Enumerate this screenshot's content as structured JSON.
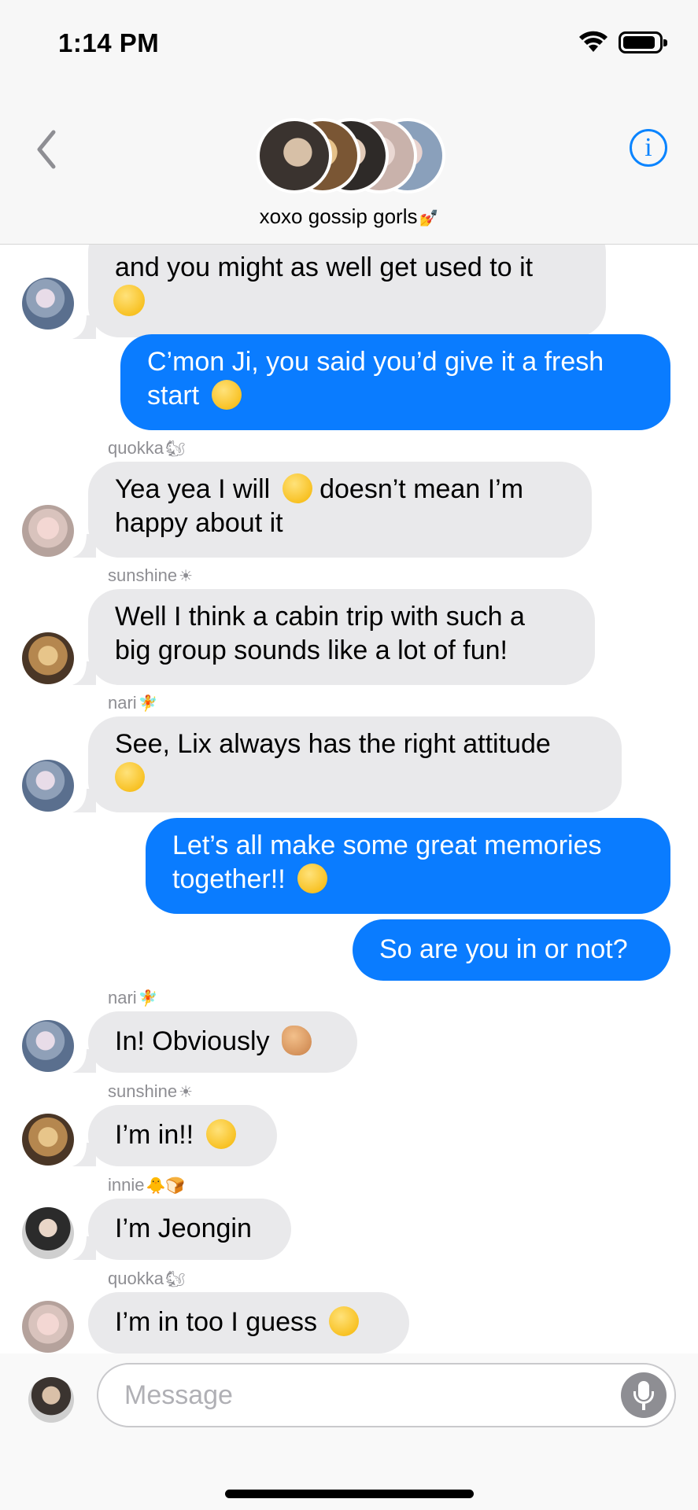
{
  "status": {
    "time": "1:14 PM"
  },
  "header": {
    "group_name": "xoxo gossip gorls",
    "group_emoji": "nail-polish-emoji",
    "info_label": "i"
  },
  "messages": [
    {
      "dir": "in",
      "line1": "and you might as well get used to it",
      "emoji": "steam-face-emoji"
    },
    {
      "dir": "out",
      "line1": "C’mon Ji, you said you’d give it a fresh",
      "line2": "start",
      "emoji": "pleading-face-emoji"
    },
    {
      "dir": "in",
      "sender": "quokka",
      "sender_emoji": "🐿",
      "line1": "Yea yea I will",
      "line1b": "doesn’t mean I’m",
      "line2": "happy about it",
      "emoji": "unamused-face-emoji"
    },
    {
      "dir": "in",
      "sender": "sunshine",
      "sender_emoji": "☀",
      "line1": "Well I think a cabin trip with such a",
      "line2": "big group sounds like a lot of fun!"
    },
    {
      "dir": "in",
      "sender": "nari",
      "sender_emoji": "🧚",
      "line1": "See, Lix always has the right attitude",
      "emoji": "relieved-face-emoji"
    },
    {
      "dir": "out",
      "line1": "Let’s all make some great memories",
      "line2": "together!!",
      "emoji": "pleading-face-emoji"
    },
    {
      "dir": "out",
      "line1": "So are you in or not?"
    },
    {
      "dir": "in",
      "sender": "nari",
      "sender_emoji": "🧚",
      "line1": "In! Obviously",
      "emoji": "tipping-hand-emoji"
    },
    {
      "dir": "in",
      "sender": "sunshine",
      "sender_emoji": "☀",
      "line1": "I’m in!!",
      "emoji": "halo-face-emoji"
    },
    {
      "dir": "in",
      "sender": "innie",
      "sender_emoji": "🐥🍞",
      "line1": "I’m Jeongin"
    },
    {
      "dir": "in",
      "sender": "quokka",
      "sender_emoji": "🐿",
      "line1": "I’m in too I guess",
      "emoji": "neutral-face-emoji"
    }
  ],
  "input": {
    "placeholder": "Message"
  },
  "colors": {
    "outgoing": "#0a7cff",
    "incoming": "#e9e9eb",
    "accent": "#0a84ff"
  }
}
